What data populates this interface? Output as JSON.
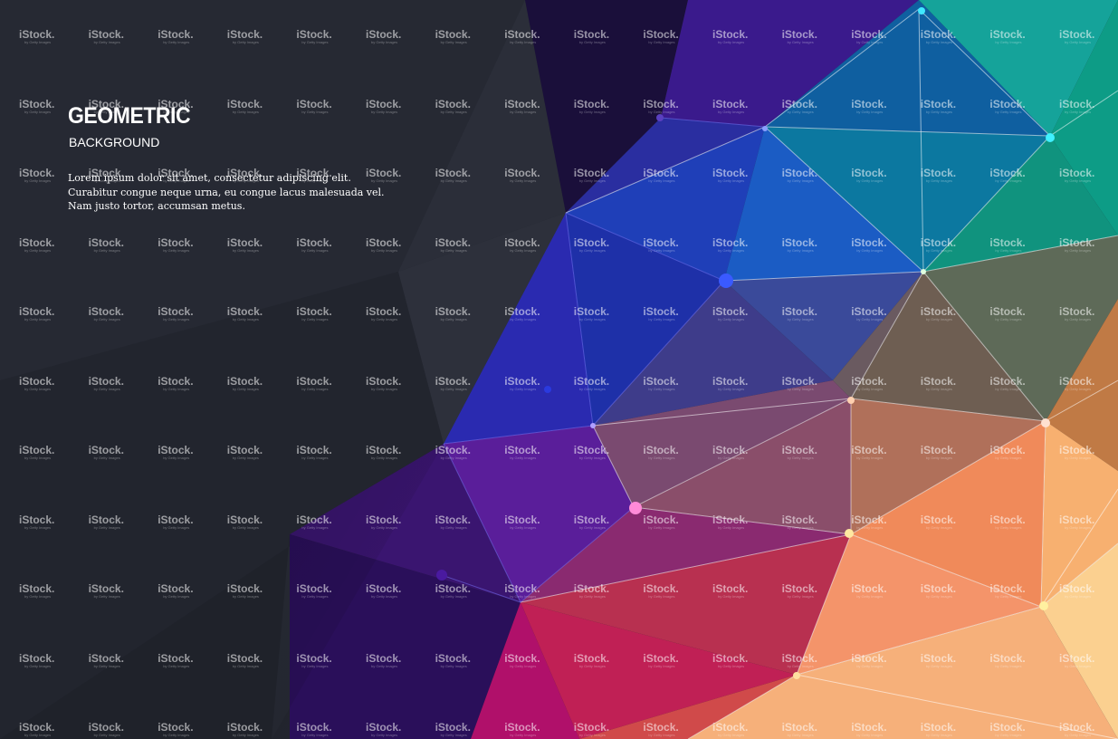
{
  "title": "GEOMETRIC",
  "subtitle": "BACKGROUND",
  "body_lines": [
    "Lorem ipsum dolor sit amet, consectetur adipiscing elit.",
    "Curabitur congue neque urna, eu congue lacus malesuada vel.",
    "Nam justo tortor, accumsan metus."
  ],
  "watermark": {
    "text": "iStock.",
    "subtext": "by Getty Images"
  },
  "colors": {
    "dark_panel": "#23262f",
    "navy": "#1b2a8c",
    "purple": "#4b1a7a",
    "magenta": "#b0145e",
    "teal": "#0a8f8a",
    "orange": "#f4a25b",
    "peach": "#f8c98a"
  }
}
